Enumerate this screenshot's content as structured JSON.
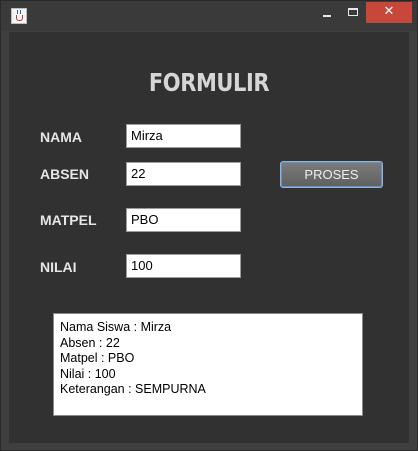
{
  "window": {
    "controls": {
      "minimize_icon": "minimize-icon",
      "maximize_icon": "maximize-icon",
      "close_glyph": "✕",
      "close_color": "#c7473b"
    },
    "app_icon": "java-cup-icon"
  },
  "form": {
    "title": "FORMULIR",
    "fields": {
      "nama": {
        "label": "NAMA",
        "value": "Mirza"
      },
      "absen": {
        "label": "ABSEN",
        "value": "22"
      },
      "matpel": {
        "label": "MATPEL",
        "value": "PBO"
      },
      "nilai": {
        "label": "NILAI",
        "value": "100"
      }
    },
    "proses_label": "PROSES"
  },
  "output": {
    "lines": [
      "Nama Siswa : Mirza",
      "Absen : 22",
      "Matpel : PBO",
      "Nilai : 100",
      "Keterangan : SEMPURNA"
    ]
  },
  "colors": {
    "window_bg": "#3f3f3f",
    "panel_bg": "#313131",
    "button_border": "#8fb3d9"
  }
}
